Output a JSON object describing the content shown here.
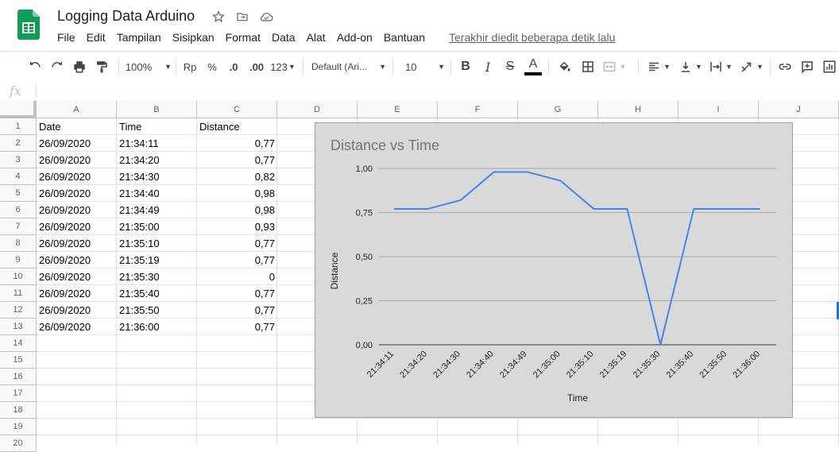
{
  "doc": {
    "title": "Logging Data Arduino",
    "last_edit": "Terakhir diedit beberapa detik lalu"
  },
  "menu": [
    "File",
    "Edit",
    "Tampilan",
    "Sisipkan",
    "Format",
    "Data",
    "Alat",
    "Add-on",
    "Bantuan"
  ],
  "toolbar": {
    "zoom": "100%",
    "currency": "Rp",
    "percent": "%",
    "dec_decrease": ".0",
    "dec_increase": ".00",
    "more_formats": "123",
    "font": "Default (Ari...",
    "font_size": "10",
    "bold": "B",
    "italic": "I",
    "strike": "S",
    "text_color": "A",
    "text_color_value": "#000000"
  },
  "formula_bar": {
    "fx": "fx",
    "value": ""
  },
  "columns": [
    "A",
    "B",
    "C",
    "D",
    "E",
    "F",
    "G",
    "H",
    "I",
    "J"
  ],
  "rows": [
    "1",
    "2",
    "3",
    "4",
    "5",
    "6",
    "7",
    "8",
    "9",
    "10",
    "11",
    "12",
    "13",
    "14",
    "15",
    "16",
    "17",
    "18",
    "19",
    "20"
  ],
  "sheet": {
    "header": [
      "Date",
      "Time",
      "Distance"
    ],
    "data": [
      [
        "26/09/2020",
        "21:34:11",
        "0,77"
      ],
      [
        "26/09/2020",
        "21:34:20",
        "0,77"
      ],
      [
        "26/09/2020",
        "21:34:30",
        "0,82"
      ],
      [
        "26/09/2020",
        "21:34:40",
        "0,98"
      ],
      [
        "26/09/2020",
        "21:34:49",
        "0,98"
      ],
      [
        "26/09/2020",
        "21:35:00",
        "0,93"
      ],
      [
        "26/09/2020",
        "21:35:10",
        "0,77"
      ],
      [
        "26/09/2020",
        "21:35:19",
        "0,77"
      ],
      [
        "26/09/2020",
        "21:35:30",
        "0"
      ],
      [
        "26/09/2020",
        "21:35:40",
        "0,77"
      ],
      [
        "26/09/2020",
        "21:35:50",
        "0,77"
      ],
      [
        "26/09/2020",
        "21:36:00",
        "0,77"
      ]
    ]
  },
  "chart_data": {
    "type": "line",
    "title": "Distance vs Time",
    "xlabel": "Time",
    "ylabel": "Distance",
    "categories": [
      "21:34:11",
      "21:34:20",
      "21:34:30",
      "21:34:40",
      "21:34:49",
      "21:35:00",
      "21:35:10",
      "21:35:19",
      "21:35:30",
      "21:35:40",
      "21:35:50",
      "21:36:00"
    ],
    "series": [
      {
        "values": [
          0.77,
          0.77,
          0.82,
          0.98,
          0.98,
          0.93,
          0.77,
          0.77,
          0,
          0.77,
          0.77,
          0.77
        ]
      }
    ],
    "ylim": [
      0,
      1
    ],
    "yticks": [
      "0,00",
      "0,25",
      "0,50",
      "0,75",
      "1,00"
    ],
    "grid": true,
    "line_color": "#4285f4",
    "background": "#d9d9d9"
  },
  "colors": {
    "brand": "#0f9d58",
    "accent": "#1a73e8"
  }
}
